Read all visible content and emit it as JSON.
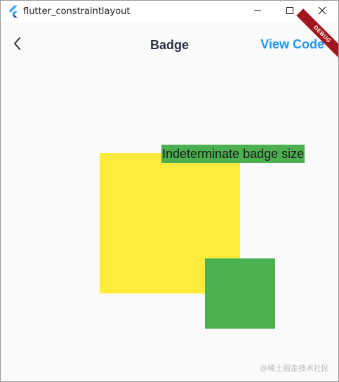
{
  "window": {
    "title": "flutter_constraintlayout",
    "minimize_icon": "minimize-icon",
    "maximize_icon": "maximize-icon",
    "close_icon": "close-icon"
  },
  "appbar": {
    "back_icon": "chevron-left-icon",
    "title": "Badge",
    "action_label": "View Code",
    "debug_label": "DEBUG"
  },
  "content": {
    "badge_text": "Indeterminate badge size",
    "watermark": "@稀土掘金技术社区"
  },
  "colors": {
    "accent": "#2196f3",
    "yellow_box": "#ffeb3b",
    "green_box": "#4caf50",
    "debug_ribbon": "#a3151d"
  }
}
